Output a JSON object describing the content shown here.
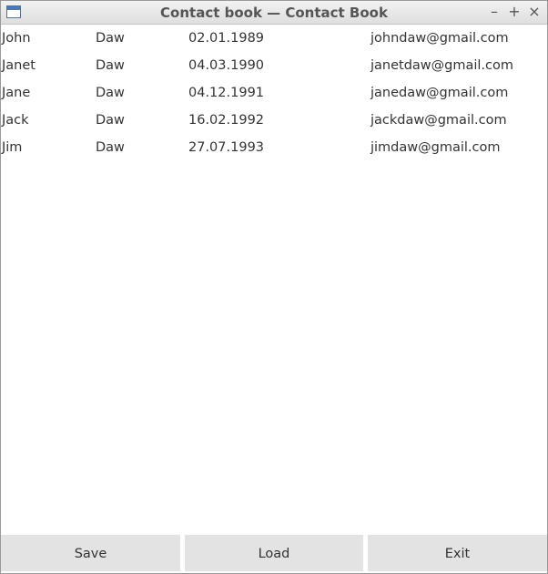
{
  "window": {
    "title": "Contact book — Contact Book",
    "minimize_glyph": "–",
    "maximize_glyph": "+",
    "close_glyph": "×"
  },
  "contacts": [
    {
      "first": "John",
      "last": "Daw",
      "birthdate": "02.01.1989",
      "email": "johndaw@gmail.com"
    },
    {
      "first": "Janet",
      "last": "Daw",
      "birthdate": "04.03.1990",
      "email": "janetdaw@gmail.com"
    },
    {
      "first": "Jane",
      "last": "Daw",
      "birthdate": "04.12.1991",
      "email": "janedaw@gmail.com"
    },
    {
      "first": "Jack",
      "last": "Daw",
      "birthdate": "16.02.1992",
      "email": "jackdaw@gmail.com"
    },
    {
      "first": "Jim",
      "last": "Daw",
      "birthdate": "27.07.1993",
      "email": "jimdaw@gmail.com"
    }
  ],
  "buttons": {
    "save": "Save",
    "load": "Load",
    "exit": "Exit"
  }
}
